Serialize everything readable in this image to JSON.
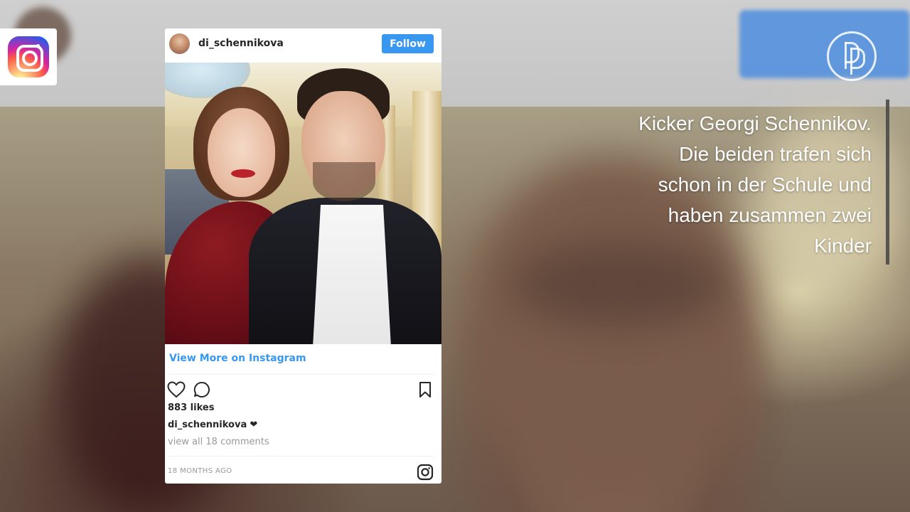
{
  "embed": {
    "username": "di_schennikova",
    "follow_label": "Follow",
    "view_more": "View More on Instagram",
    "likes": "883 likes",
    "caption_user": "di_schennikova",
    "caption_text": "❤",
    "comments_link": "view all 18 comments",
    "timestamp": "18 MONTHS AGO"
  },
  "caption": {
    "lines": [
      "Kicker Georgi Schennikov.",
      "Die beiden trafen sich",
      "schon in der Schule und",
      "haben zusammen zwei",
      "Kinder"
    ]
  },
  "colors": {
    "follow_blue": "#3897f0",
    "link_blue": "#3897f0",
    "text_dark": "#262626",
    "text_muted": "#999999"
  },
  "icons": [
    "instagram-logo-icon",
    "publisher-logo-icon",
    "heart-icon",
    "comment-icon",
    "bookmark-icon",
    "instagram-glyph-icon"
  ]
}
